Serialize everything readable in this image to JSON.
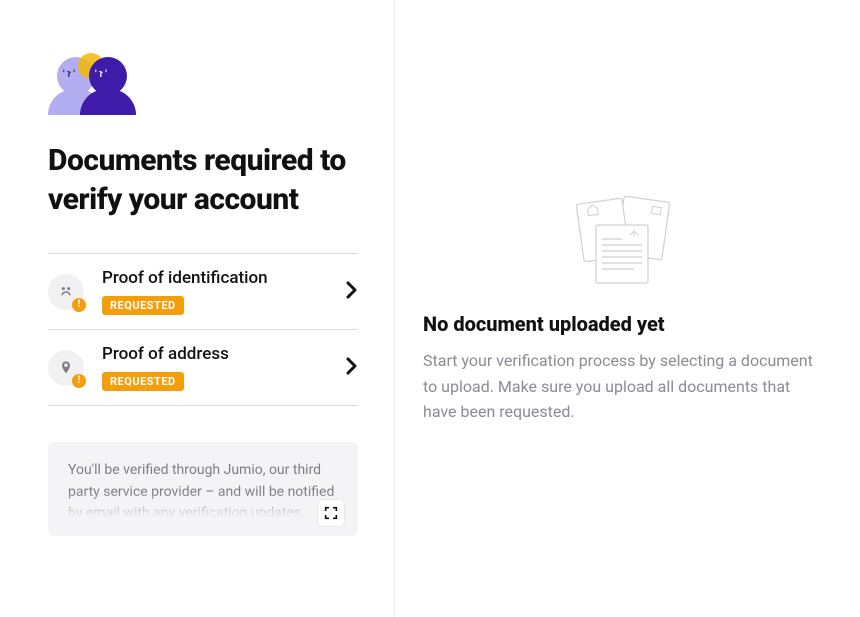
{
  "left": {
    "heading": "Documents required to verify your account",
    "items": [
      {
        "title": "Proof of identification",
        "status": "REQUESTED",
        "icon": "id-icon"
      },
      {
        "title": "Proof of address",
        "status": "REQUESTED",
        "icon": "location-pin-icon"
      }
    ],
    "notice": "You'll be verified through Jumio, our third party service provider – and will be notified by email with any verification updates."
  },
  "right": {
    "emptyTitle": "No document uploaded yet",
    "emptyDesc": "Start your verification process by selecting a document to upload. Make sure you upload all documents that have been requested."
  },
  "colors": {
    "accent_orange": "#f59e0b",
    "brand_purple": "#3e1ba8",
    "brand_lavender": "#b3aef2"
  }
}
